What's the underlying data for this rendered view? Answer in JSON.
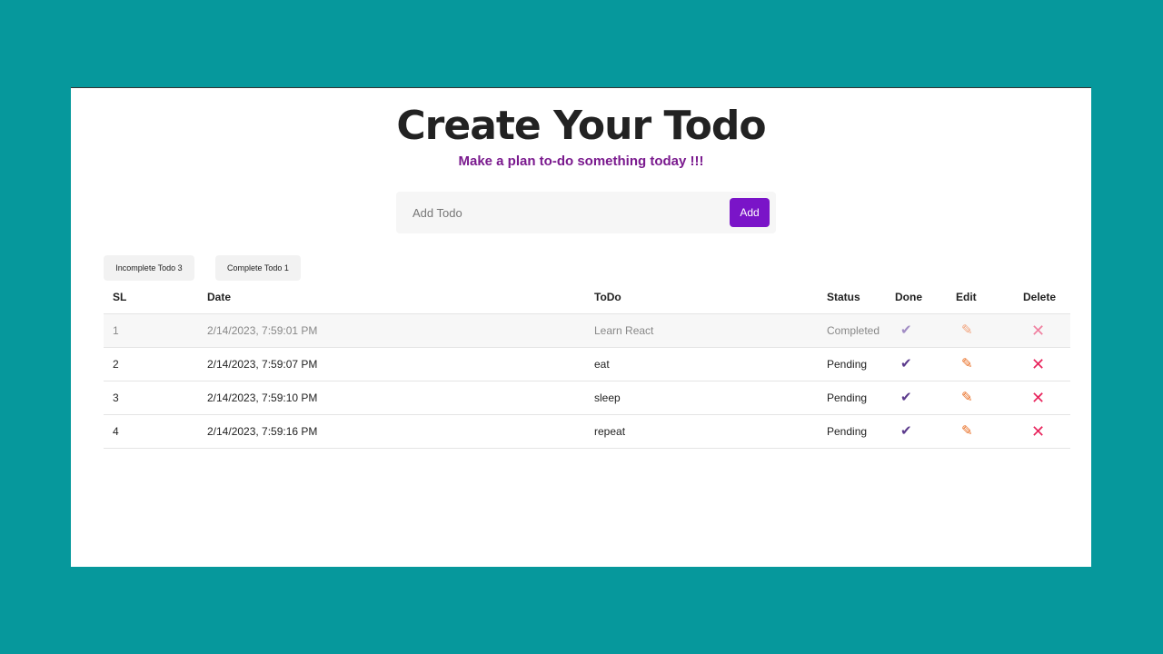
{
  "header": {
    "title": "Create Your Todo",
    "subtitle": "Make a plan to-do something today !!!"
  },
  "add_form": {
    "placeholder": "Add Todo",
    "value": "",
    "button_label": "Add"
  },
  "filters": {
    "incomplete_label": "Incomplete Todo 3",
    "complete_label": "Complete Todo 1"
  },
  "table": {
    "columns": {
      "sl": "SL",
      "date": "Date",
      "todo": "ToDo",
      "status": "Status",
      "done": "Done",
      "edit": "Edit",
      "delete": "Delete"
    },
    "rows": [
      {
        "sl": "1",
        "date": "2/14/2023, 7:59:01 PM",
        "todo": "Learn React",
        "status": "Completed"
      },
      {
        "sl": "2",
        "date": "2/14/2023, 7:59:07 PM",
        "todo": "eat",
        "status": "Pending"
      },
      {
        "sl": "3",
        "date": "2/14/2023, 7:59:10 PM",
        "todo": "sleep",
        "status": "Pending"
      },
      {
        "sl": "4",
        "date": "2/14/2023, 7:59:16 PM",
        "todo": "repeat",
        "status": "Pending"
      }
    ]
  },
  "icons": {
    "done": "check-icon",
    "edit": "pencil-icon",
    "delete": "close-icon"
  },
  "colors": {
    "background": "#06989c",
    "accent": "#7a14c8",
    "subtitle": "#7a1a8e",
    "delete": "#e8245c",
    "edit": "#e86a1e",
    "done": "#5b3a8c"
  }
}
